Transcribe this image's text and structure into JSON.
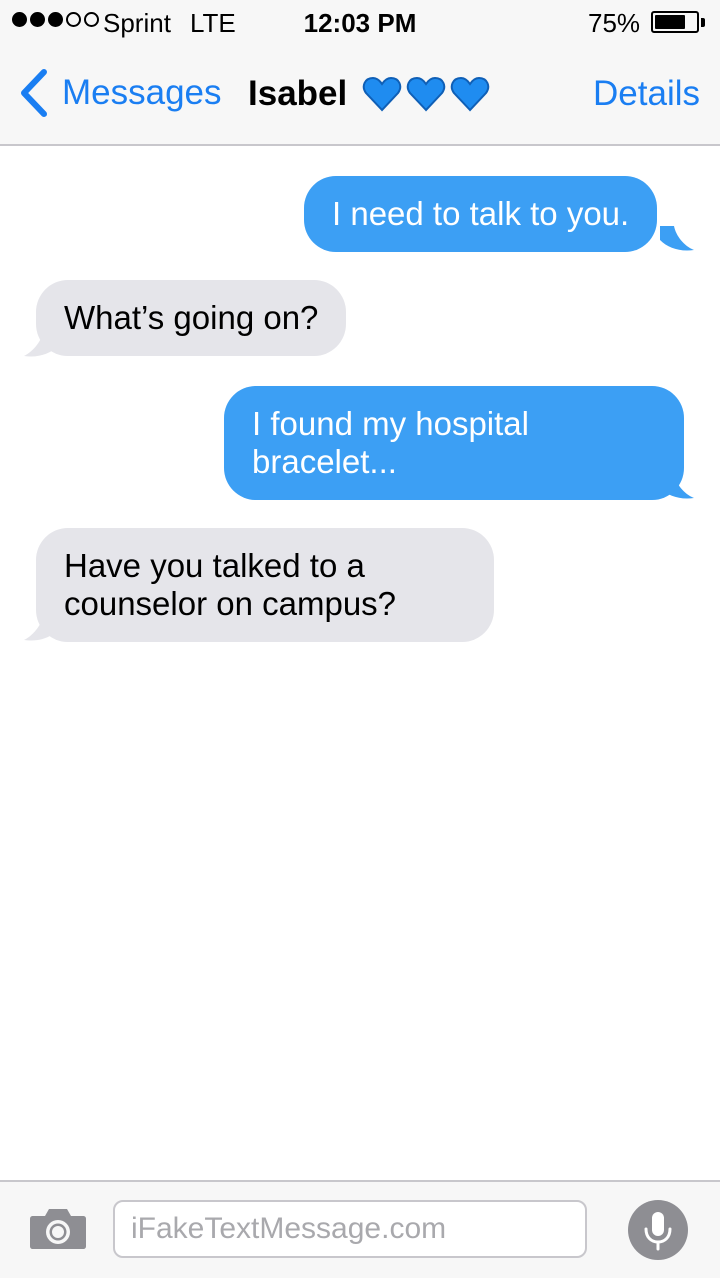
{
  "status_bar": {
    "carrier": "Sprint",
    "network": "LTE",
    "time": "12:03 PM",
    "battery_percent_label": "75%",
    "battery_level": 0.75,
    "signal_bars_filled": 3,
    "signal_bars_total": 5
  },
  "nav": {
    "back_label": "Messages",
    "contact_name": "Isabel",
    "contact_emoji": [
      "blue-heart",
      "blue-heart",
      "blue-heart"
    ],
    "details_label": "Details"
  },
  "messages": [
    {
      "direction": "outgoing",
      "text": "I need to talk to you."
    },
    {
      "direction": "incoming",
      "text": "What’s going on?"
    },
    {
      "direction": "outgoing",
      "text_lines": [
        "I found my hospital",
        "bracelet..."
      ]
    },
    {
      "direction": "incoming",
      "text_lines": [
        "Have you talked to a",
        "counselor on campus?"
      ]
    }
  ],
  "input": {
    "placeholder": "iFakeTextMessage.com"
  },
  "colors": {
    "accent": "#1a7ef2",
    "outgoing_bubble": "#3c9ff4",
    "incoming_bubble": "#e5e5ea",
    "bar_background": "#f7f7f7"
  }
}
